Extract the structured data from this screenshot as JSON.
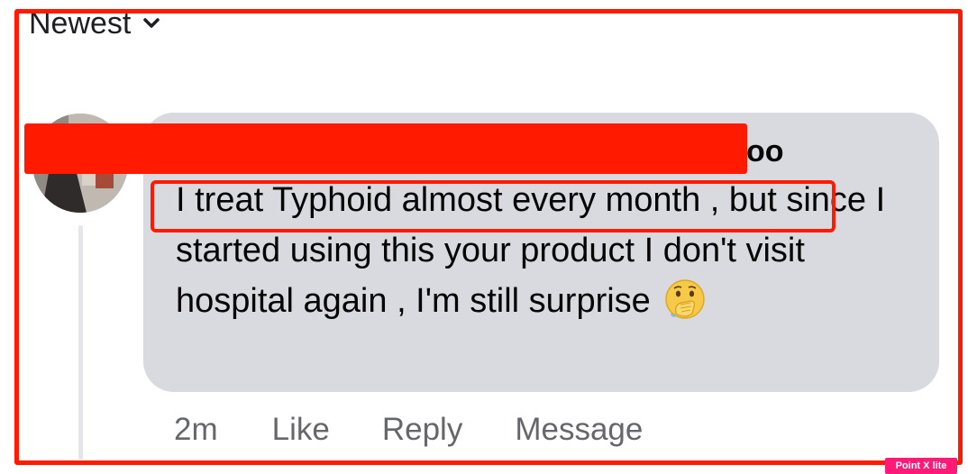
{
  "sort": {
    "label": "Newest",
    "icon": "chevron-down-icon"
  },
  "comment": {
    "author_visible_suffix": "oo",
    "text_line1_highlight": "I treat Typhoid almost every month ,",
    "text_line1_rest": " but",
    "text_rest": "since I started using this your product I don't visit hospital again , I'm still surprise",
    "emoji": "face-with-hand-over-mouth-icon"
  },
  "actions": {
    "timestamp": "2m",
    "like_label": "Like",
    "reply_label": "Reply",
    "message_label": "Message"
  },
  "watermark_text": "Point X lite",
  "colors": {
    "annotation_red": "#ff1a00",
    "bubble_bg": "#d8dadf",
    "meta_text": "#65676b"
  }
}
